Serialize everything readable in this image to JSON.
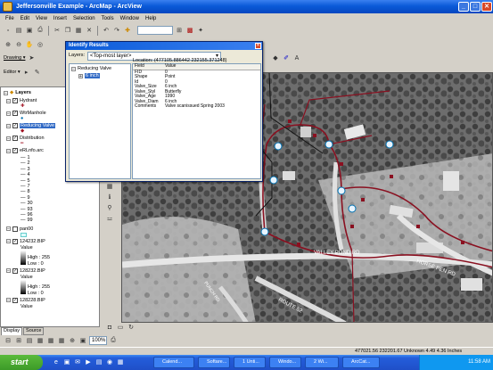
{
  "window": {
    "title": "Jeffersonville Example - ArcMap - ArcView",
    "min": "_",
    "max": "□",
    "close": "✕"
  },
  "menu": [
    "File",
    "Edit",
    "View",
    "Insert",
    "Selection",
    "Tools",
    "Window",
    "Help"
  ],
  "toolbar": {
    "scale": "",
    "drawing_label": "Drawing ▾",
    "editor_label": "Editor ▾"
  },
  "toc": {
    "root": "Layers",
    "items": [
      {
        "label": "Hydrant",
        "checked": true
      },
      {
        "label": "WtrManhole",
        "checked": true
      },
      {
        "label": "Reducing Valve",
        "checked": true,
        "selected": true
      },
      {
        "label": "Distribution",
        "checked": true
      },
      {
        "label": "eRLnfo.arc",
        "checked": true
      }
    ],
    "legend_values": [
      "1",
      "2",
      "3",
      "4",
      "5",
      "7",
      "8",
      "9",
      "30",
      "93",
      "96",
      "99"
    ],
    "rasters": [
      {
        "label": "pan00",
        "checked": false
      },
      {
        "label": "124232.BIP",
        "checked": true,
        "value": "Value",
        "high": "High : 255",
        "low": "Low : 0"
      },
      {
        "label": "128232.BIP",
        "checked": true,
        "value": "Value",
        "high": "High : 255",
        "low": "Low : 0"
      },
      {
        "label": "128228.BIP",
        "checked": true,
        "value": "Value"
      }
    ],
    "tabs": [
      "Display",
      "Source"
    ]
  },
  "identify": {
    "title": "Identify Results",
    "layers_label": "Layers:",
    "layers_value": "<Top-most layer>",
    "tree_root": "Reducing Valve",
    "tree_child": "6 inch",
    "location": "Location: (477105.886442 232155.371248)",
    "headers": [
      "Field",
      "Value"
    ],
    "rows": [
      [
        "FID",
        "0"
      ],
      [
        "Shape",
        "Point"
      ],
      [
        "Id",
        "0"
      ],
      [
        "Valve_Size",
        "6 inch"
      ],
      [
        "Valve_Styl",
        "Butterfly"
      ],
      [
        "Valve_Age",
        "1990"
      ],
      [
        "Valve_Diam",
        "6 inch"
      ],
      [
        "Comments",
        "Valve scanissued Spring 2003"
      ]
    ]
  },
  "map": {
    "labels": [
      "VALLEY POND RD",
      "HORSE PEN RD",
      "ROUTE 52",
      "PUNCH RD"
    ]
  },
  "status": {
    "coords": "477021.56  232201.67 Unknown 4.49 4.36 Inches"
  },
  "taskbar": {
    "start": "start",
    "tasks": [
      "Calend...",
      "Softare...",
      "1 Unti...",
      "Windo...",
      "2 Wi...",
      "ArcCat..."
    ],
    "clock": "11:58 AM"
  }
}
